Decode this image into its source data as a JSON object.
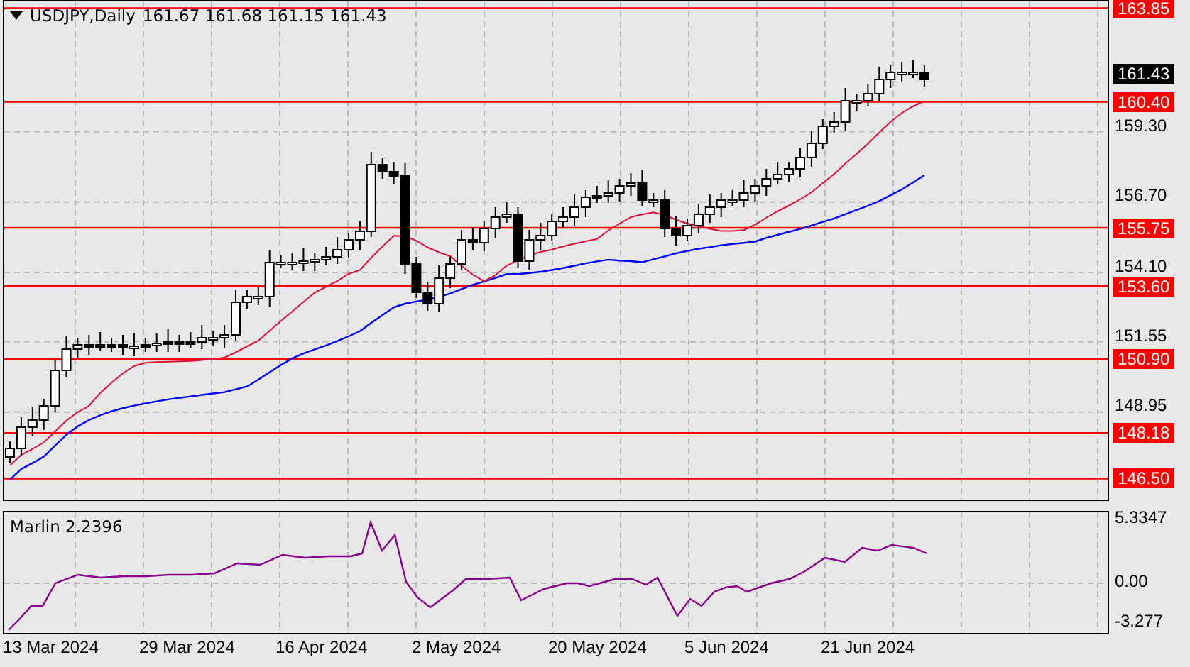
{
  "chart": {
    "title": "USDJPY,Daily",
    "ohlc": "161.67 161.68 161.15 161.43",
    "price_ticks": [
      "159.30",
      "156.70",
      "154.10",
      "151.55",
      "148.95"
    ],
    "levels": [
      "163.85",
      "160.40",
      "155.75",
      "153.60",
      "150.90",
      "148.18",
      "146.50"
    ],
    "current_price": "161.43"
  },
  "oscillator": {
    "title": "Marlin 2.2396",
    "ticks": [
      "5.3347",
      "0.00",
      "-3.277"
    ]
  },
  "dates": [
    "13 Mar 2024",
    "29 Mar 2024",
    "16 Apr 2024",
    "2 May 2024",
    "20 May 2024",
    "5 Jun 2024",
    "21 Jun 2024"
  ]
}
